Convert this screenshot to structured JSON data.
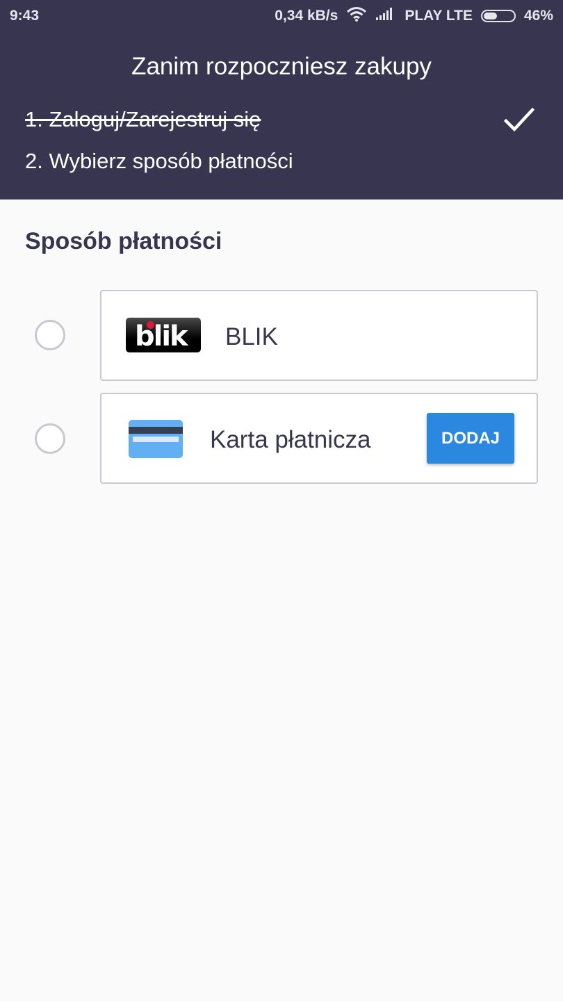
{
  "status_bar": {
    "time": "9:43",
    "network_speed": "0,34 kB/s",
    "carrier": "PLAY LTE",
    "battery": "46%",
    "battery_level": 0.46
  },
  "header": {
    "title": "Zanim rozpoczniesz zakupy",
    "steps": [
      {
        "label": "1. Zaloguj/Zarejestruj się",
        "completed": true
      },
      {
        "label": "2. Wybierz sposób płatności",
        "completed": false
      }
    ]
  },
  "payment": {
    "section_title": "Sposób płatności",
    "options": [
      {
        "logo_text": "blik",
        "label": "BLIK",
        "selected": false
      },
      {
        "icon": "credit-card-icon",
        "label": "Karta płatnicza",
        "button_label": "DODAJ",
        "selected": false
      }
    ]
  },
  "colors": {
    "header_bg": "#383551",
    "accent": "#2b88e0",
    "page_bg": "#fafafa",
    "card_icon": "#62b0f3",
    "blik_dot": "#e3173e"
  }
}
